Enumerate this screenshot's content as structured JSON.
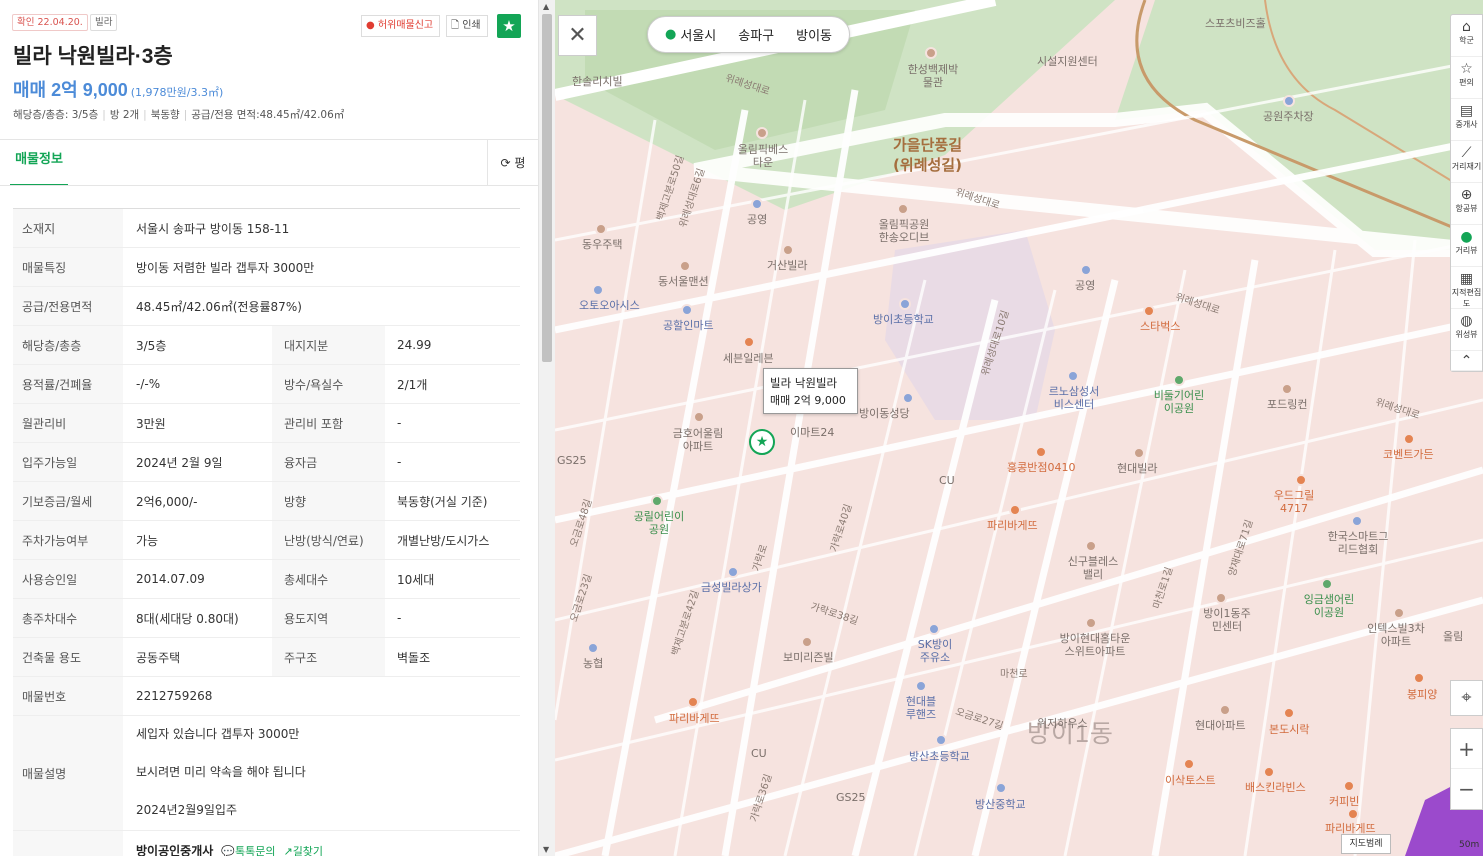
{
  "listing": {
    "confirm_tag": "확인 22.04.20.",
    "type_tag": "빌라",
    "report_label": "허위매물신고",
    "print_label": "인쇄",
    "title": "빌라 낙원빌라·3층",
    "price": "매매 2억 9,000",
    "price_sub": "(1,978만원/3.3㎡)",
    "summary": [
      "해당층/총층: 3/5층",
      "방 2개",
      "북동향",
      "공급/전용 면적:48.45㎡/42.06㎡"
    ]
  },
  "tabs": {
    "info": "매물정보",
    "unit": "평"
  },
  "details": {
    "address": {
      "k": "소재지",
      "v": "서울시 송파구 방이동 158-11"
    },
    "feature": {
      "k": "매물특징",
      "v": "방이동 저렴한 빌라 갭투자 3000만"
    },
    "area": {
      "k": "공급/전용면적",
      "v": "48.45㎡/42.06㎡(전용률87%)"
    },
    "pairs": [
      {
        "k1": "해당층/총층",
        "v1": "3/5층",
        "k2": "대지지분",
        "v2": "24.99"
      },
      {
        "k1": "용적률/건폐율",
        "v1": "-/-%",
        "k2": "방수/욕실수",
        "v2": "2/1개"
      },
      {
        "k1": "월관리비",
        "v1": "3만원",
        "k2": "관리비 포함",
        "v2": "-"
      },
      {
        "k1": "입주가능일",
        "v1": "2024년 2월 9일",
        "k2": "융자금",
        "v2": "-"
      },
      {
        "k1": "기보증금/월세",
        "v1": "2억6,000/-",
        "k2": "방향",
        "v2": "북동향(거실 기준)"
      },
      {
        "k1": "주차가능여부",
        "v1": "가능",
        "k2": "난방(방식/연료)",
        "v2": "개별난방/도시가스"
      },
      {
        "k1": "사용승인일",
        "v1": "2014.07.09",
        "k2": "총세대수",
        "v2": "10세대"
      },
      {
        "k1": "총주차대수",
        "v1": "8대(세대당 0.80대)",
        "k2": "용도지역",
        "v2": "-"
      },
      {
        "k1": "건축물 용도",
        "v1": "공동주택",
        "k2": "주구조",
        "v2": "벽돌조"
      }
    ],
    "number": {
      "k": "매물번호",
      "v": "2212759268"
    },
    "description": {
      "k": "매물설명",
      "lines": [
        "세입자 있습니다 갭투자 3000만",
        "보시려면 미리 약속을 해야 됩니다",
        "2024년2월9일입주"
      ]
    },
    "agent": {
      "name": "방이공인중개사",
      "chat": "톡톡문의",
      "route": "길찾기"
    }
  },
  "map": {
    "location": [
      "서울시",
      "송파구",
      "방이동"
    ],
    "popup_title": "빌라 낙원빌라",
    "popup_price": "매매 2억 9,000",
    "district_label": "방이1동",
    "area_label": "가을단풍길\n(위례성길)",
    "tools": [
      {
        "icon": "school-icon",
        "label": "학군"
      },
      {
        "icon": "convenience-icon",
        "label": "편의"
      },
      {
        "icon": "agent-icon",
        "label": "중개사"
      },
      {
        "icon": "ruler-icon",
        "label": "거리재기"
      },
      {
        "icon": "aerial-icon",
        "label": "항공뷰"
      },
      {
        "icon": "street-view-icon",
        "label": "거리뷰"
      },
      {
        "icon": "cadastral-icon",
        "label": "지적편집도"
      },
      {
        "icon": "satellite-icon",
        "label": "위성뷰"
      }
    ],
    "scale_button": "지도범례",
    "scale_text": "50m",
    "places": [
      "한솔리치빌",
      "한성백제박물관",
      "시설지원센터",
      "스포츠비즈홀",
      "공원주차장",
      "올림픽베스타운",
      "공영",
      "동우주택",
      "거산빌라",
      "동서울맨션",
      "오토오아시스",
      "올림픽공원한송오디브",
      "공할인마트",
      "세븐일레븐",
      "방이초등학교",
      "공영",
      "스타벅스",
      "르노삼성서비스센터",
      "비둘기어린이공원",
      "포드링컨",
      "방이동성당",
      "이마트24",
      "금호어울림아파트",
      "GS25",
      "CU",
      "홍콩반점0410",
      "현대빌라",
      "코벤트가든",
      "우드그릴4717",
      "공릴어린이공원",
      "파리바게뜨",
      "신구블레스밸리",
      "한국스마트그리드협회",
      "금성빌라상가",
      "잉금샘어린이공원",
      "방이1동주민센터",
      "인텍스빌3차아파트",
      "SK방이주유소",
      "보미리즌빌",
      "방이현대홈타운스위트아파트",
      "농협",
      "현대블루핸즈",
      "위저하우스",
      "현대아파트",
      "본도시락",
      "방산초등학교",
      "파리바게뜨",
      "CU",
      "GS25",
      "이삭토스트",
      "배스킨라빈스",
      "방산중학교",
      "커피빈",
      "파리바게뜨",
      "봉피양",
      "올림"
    ],
    "roads": [
      "위례성대로",
      "백제고분로50길",
      "위례성대로6길",
      "백제고분로48길",
      "위례성대로",
      "위례성대로",
      "위례성대로",
      "가락로",
      "가락로40길",
      "가락로38길",
      "오금로27길",
      "마천로",
      "백제고분로42길",
      "오금로23길",
      "가락로36길",
      "양재대로71길",
      "위례성대로10길",
      "오금로48길",
      "마천로1길"
    ]
  }
}
